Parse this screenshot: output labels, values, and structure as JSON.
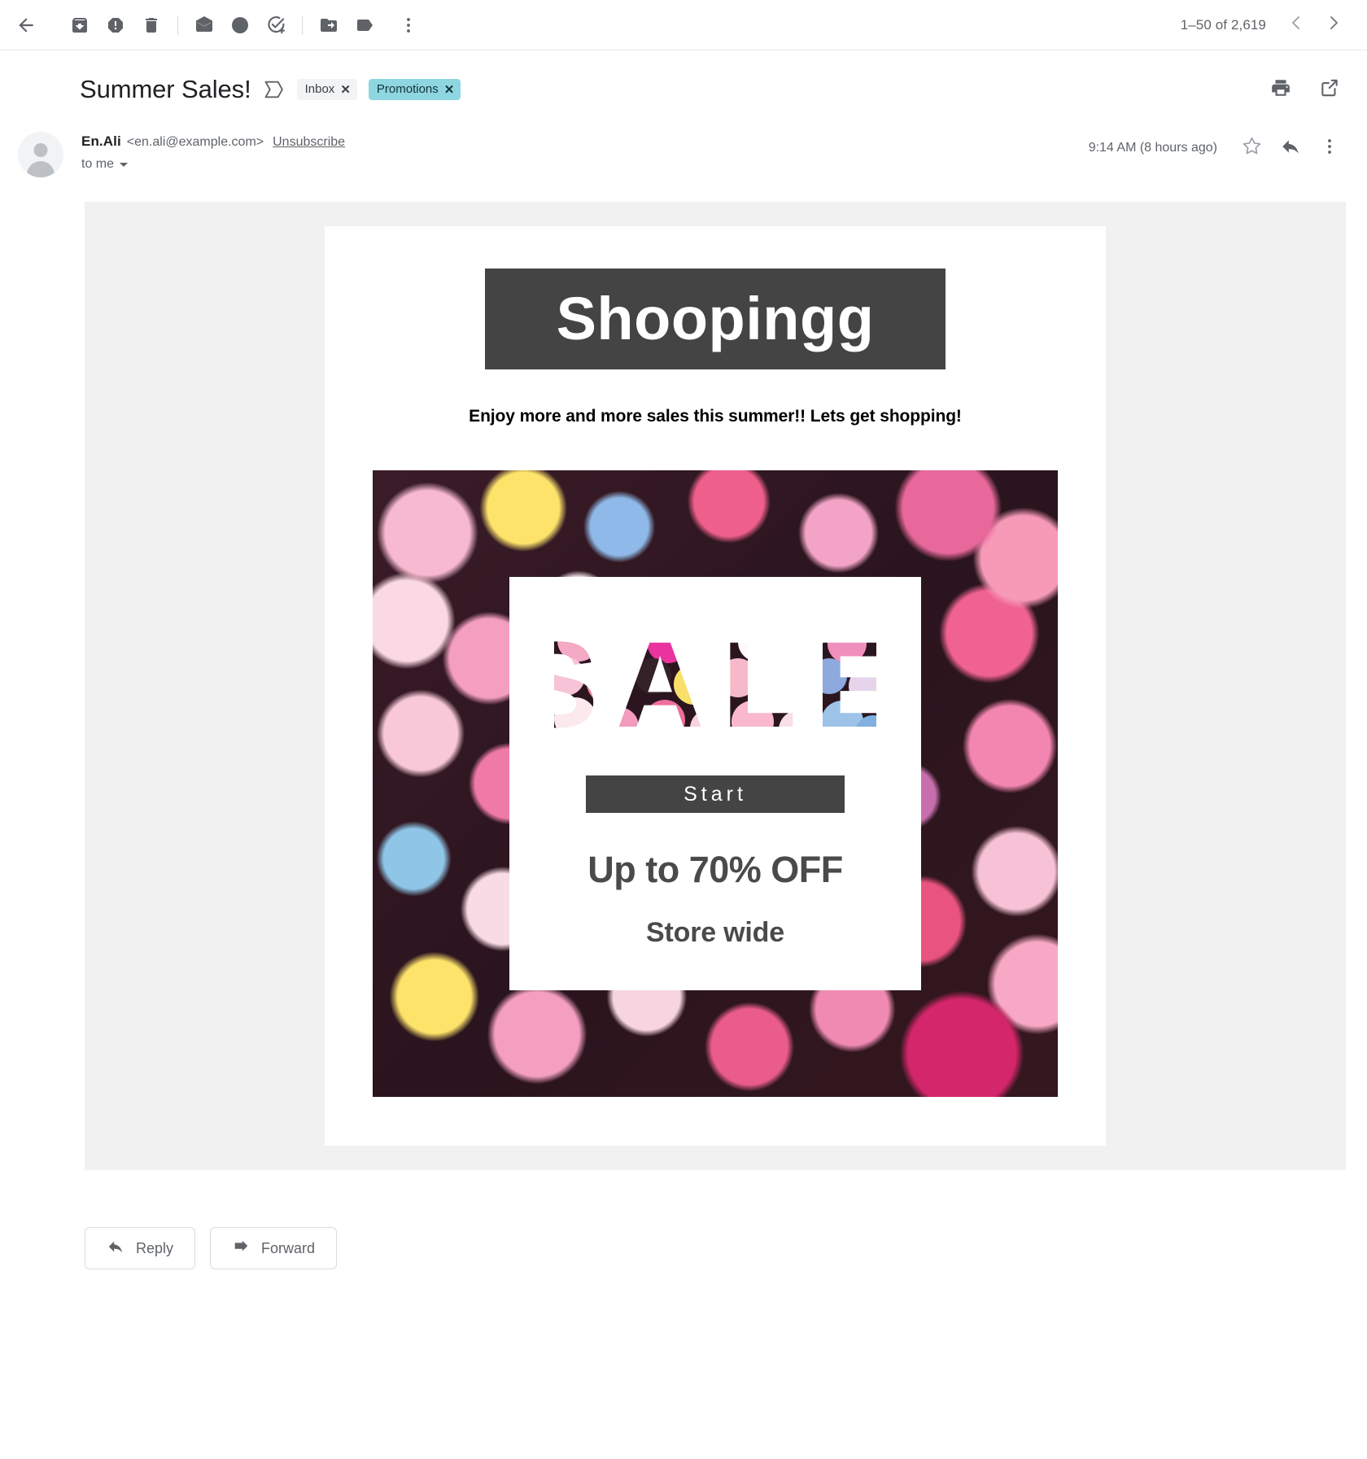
{
  "toolbar": {
    "back_label": "Back to inbox",
    "icons": [
      {
        "name": "back-arrow-icon",
        "label": "Back"
      },
      {
        "name": "archive-icon",
        "label": "Archive"
      },
      {
        "name": "report-spam-icon",
        "label": "Report spam"
      },
      {
        "name": "delete-icon",
        "label": "Delete"
      },
      {
        "name": "mark-unread-icon",
        "label": "Mark as unread"
      },
      {
        "name": "snooze-clock-icon",
        "label": "Snooze"
      },
      {
        "name": "add-to-tasks-icon",
        "label": "Add to tasks"
      },
      {
        "name": "move-to-icon",
        "label": "Move to"
      },
      {
        "name": "labels-icon",
        "label": "Labels"
      },
      {
        "name": "more-options-icon",
        "label": "More"
      }
    ],
    "pager": {
      "count_text": "1–50 of 2,619",
      "prev_label": "Older",
      "next_label": "Newer"
    }
  },
  "subject": {
    "title": "Summer Sales!",
    "important_marker_label": "Important",
    "labels": [
      {
        "text": "Inbox",
        "remove": "✕",
        "style": "gray"
      },
      {
        "text": "Promotions",
        "remove": "✕",
        "style": "teal"
      }
    ],
    "print_label": "Print all",
    "popout_label": "Open in new window"
  },
  "message": {
    "sender_name": "En.Ali",
    "sender_email": "<en.ali@example.com>",
    "unsubscribe_label": "Unsubscribe",
    "recipient_line": "to me",
    "timestamp": "9:14 AM (8 hours ago)",
    "star_label": "Not starred",
    "reply_label": "Reply",
    "more_label": "More"
  },
  "email_content": {
    "brand": "Shoopingg",
    "tagline": "Enjoy more and more sales this summer!! Lets get shopping!",
    "sale_heading": "SALE",
    "cta_button": "Start",
    "discount": "Up to 70% OFF",
    "scope": "Store wide"
  },
  "footer": {
    "reply_label": "Reply",
    "forward_label": "Forward"
  },
  "colors": {
    "brand_banner": "#444444",
    "promotions_label": "#8ed6e0",
    "inbox_label": "#f1f3f4",
    "body_backdrop": "#f1f1f1",
    "text_muted": "#5f6368",
    "promo_text": "#4a4a4a"
  }
}
